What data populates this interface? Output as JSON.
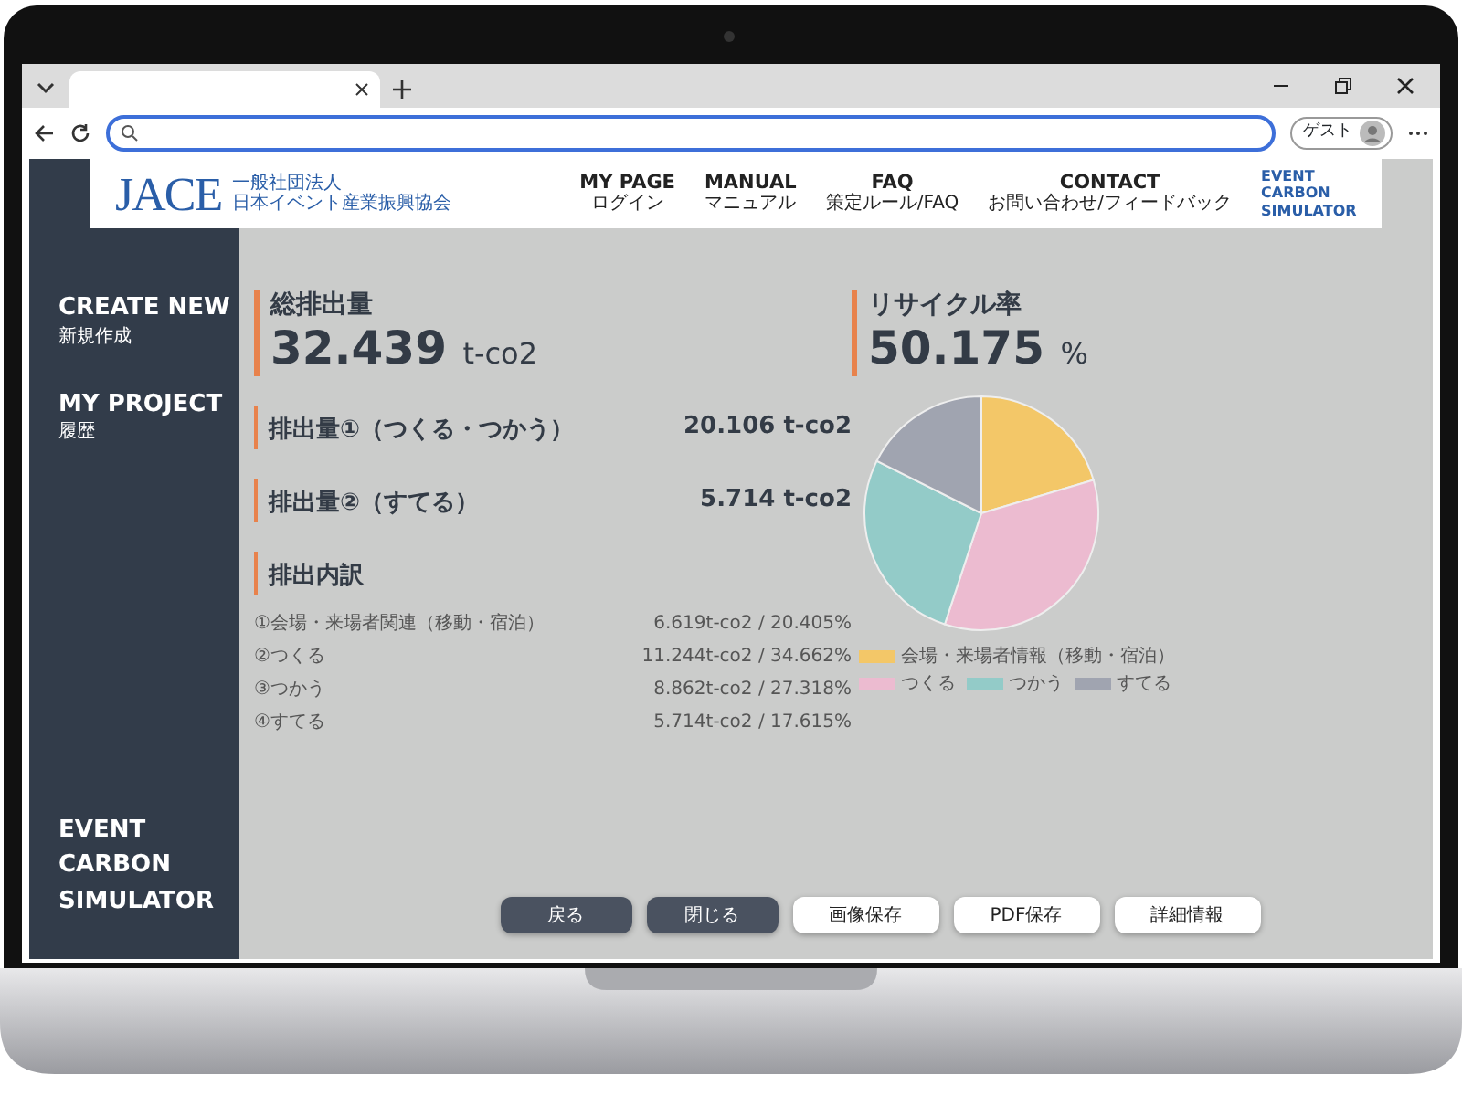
{
  "browser": {
    "profile": "ゲスト"
  },
  "header": {
    "logo": "JACE",
    "org": [
      "一般社団法人",
      "日本イベント産業振興協会"
    ],
    "nav": [
      {
        "title": "MY PAGE",
        "subtitle": "ログイン"
      },
      {
        "title": "MANUAL",
        "subtitle": "マニュアル"
      },
      {
        "title": "FAQ",
        "subtitle": "策定ルール/FAQ"
      },
      {
        "title": "CONTACT",
        "subtitle": "お問い合わせ/フィードバック"
      }
    ],
    "product": "EVENT CARBON SIMULATOR"
  },
  "sidebar": {
    "items": [
      {
        "title": "CREATE NEW",
        "subtitle": "新規作成"
      },
      {
        "title": "MY PROJECT",
        "subtitle": "履歴"
      }
    ],
    "footer": "EVENT CARBON SIMULATOR"
  },
  "summary": [
    {
      "label": "総排出量",
      "value": "32.439",
      "unit": "t-co2"
    },
    {
      "label": "リサイクル率",
      "value": "50.175",
      "unit": "%"
    }
  ],
  "subtotals": [
    {
      "label": "排出量①（つくる・つかう）",
      "value": "20.106 t-co2"
    },
    {
      "label": "排出量②（すてる）",
      "value": "5.714 t-co2"
    }
  ],
  "breakdown": {
    "title": "排出内訳",
    "rows": [
      {
        "label": "①会場・来場者関連（移動・宿泊）",
        "value": "6.619t-co2 / 20.405%"
      },
      {
        "label": "②つくる",
        "value": "11.244t-co2 / 34.662%"
      },
      {
        "label": "③つかう",
        "value": "8.862t-co2 / 27.318%"
      },
      {
        "label": "④すてる",
        "value": "5.714t-co2 / 17.615%"
      }
    ]
  },
  "chart": {
    "chart_data": {
      "type": "pie",
      "categories": [
        "会場・来場者情報（移動・宿泊）",
        "つくる",
        "つかう",
        "すてる"
      ],
      "colors": [
        "#f3c768",
        "#ecbbd0",
        "#93cbc8",
        "#a0a4b0"
      ],
      "legend": true,
      "series": [
        {
          "values": [
            20.405,
            34.662,
            27.318,
            17.615
          ]
        }
      ]
    }
  },
  "buttons": [
    {
      "label": "戻る",
      "kind": "dark"
    },
    {
      "label": "閉じる",
      "kind": "dark"
    },
    {
      "label": "画像保存",
      "kind": "light"
    },
    {
      "label": "PDF保存",
      "kind": "light"
    },
    {
      "label": "詳細情報",
      "kind": "light"
    }
  ]
}
